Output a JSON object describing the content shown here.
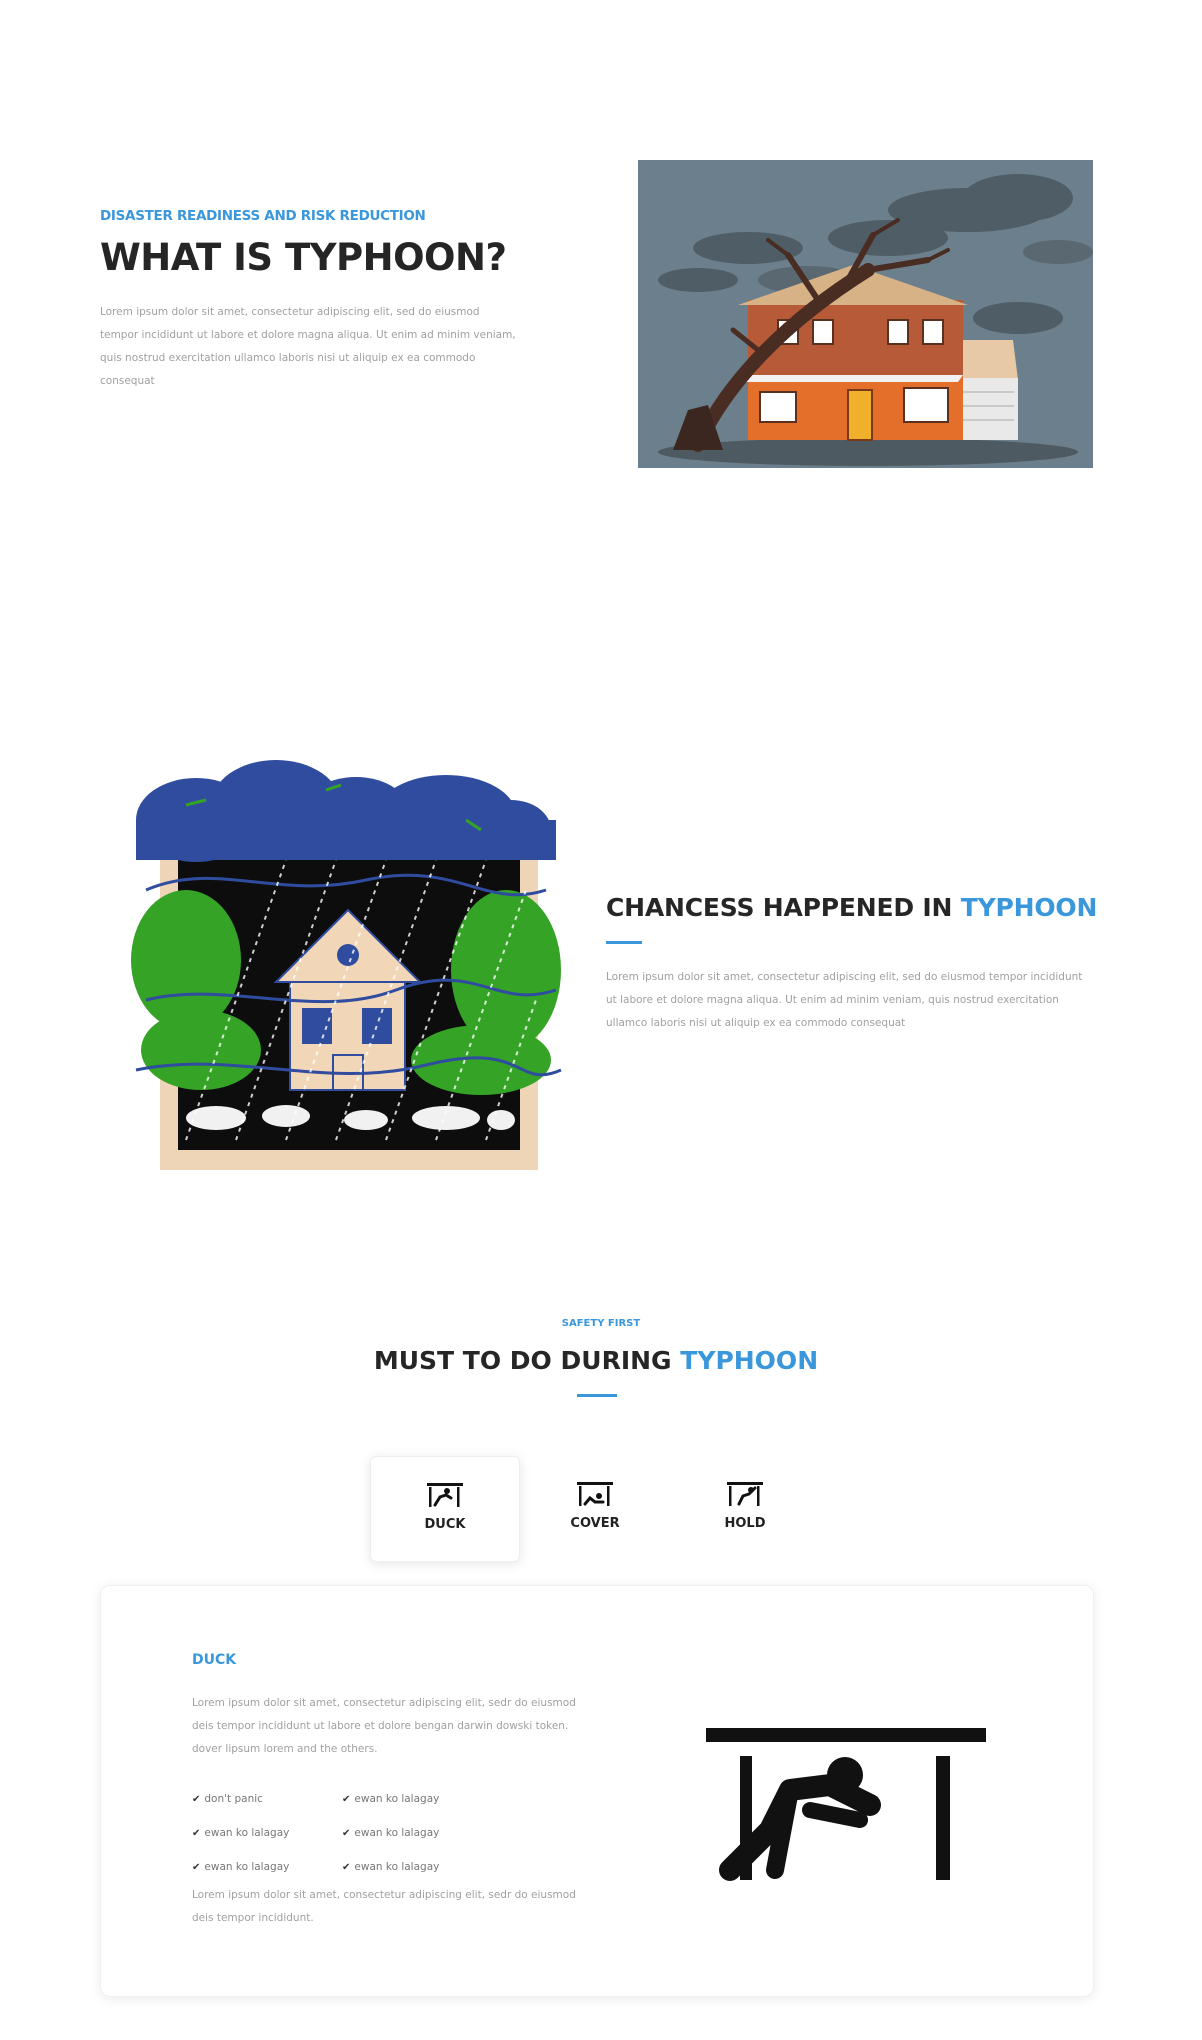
{
  "section1": {
    "eyebrow": "DISASTER READINESS AND RISK REDUCTION",
    "title": "WHAT IS TYPHOON?",
    "paragraph": "Lorem ipsum dolor sit amet, consectetur adipiscing elit, sed do eiusmod tempor incididunt ut labore et dolore magna aliqua. Ut enim ad minim veniam, quis nostrud exercitation ullamco laboris nisi ut aliquip ex ea commodo consequat"
  },
  "section2": {
    "title_part1": "CHANCESS HAPPENED IN ",
    "title_part2": "TYPHOON",
    "paragraph": "Lorem ipsum dolor sit amet, consectetur adipiscing elit, sed do eiusmod tempor incididunt ut labore et dolore magna aliqua. Ut enim ad minim veniam, quis nostrud exercitation ullamco laboris nisi ut aliquip ex ea commodo consequat"
  },
  "section3": {
    "eyebrow": "SAFETY FIRST",
    "title_part1": "MUST TO DO DURING ",
    "title_part2": "TYPHOON",
    "tabs": [
      {
        "label": "DUCK",
        "icon": "duck-icon"
      },
      {
        "label": "COVER",
        "icon": "cover-icon"
      },
      {
        "label": "HOLD",
        "icon": "hold-icon"
      }
    ],
    "active_tab": "DUCK",
    "card": {
      "title": "DUCK",
      "paragraph": "Lorem ipsum dolor sit amet, consectetur adipiscing elit, sedr do eiusmod deis tempor incididunt ut labore et dolore bengan darwin dowski token. dover lipsum lorem and the others.",
      "checks": [
        [
          "don't panic",
          "ewan ko lalagay"
        ],
        [
          "ewan ko lalagay",
          "ewan ko lalagay"
        ],
        [
          "ewan ko lalagay",
          "ewan ko lalagay"
        ]
      ],
      "paragraph2": "Lorem ipsum dolor sit amet, consectetur adipiscing elit, sedr do eiusmod deis tempor incididunt."
    }
  },
  "colors": {
    "accent": "#3a97db",
    "heading": "#262626",
    "body_text": "#a0a0a0"
  }
}
